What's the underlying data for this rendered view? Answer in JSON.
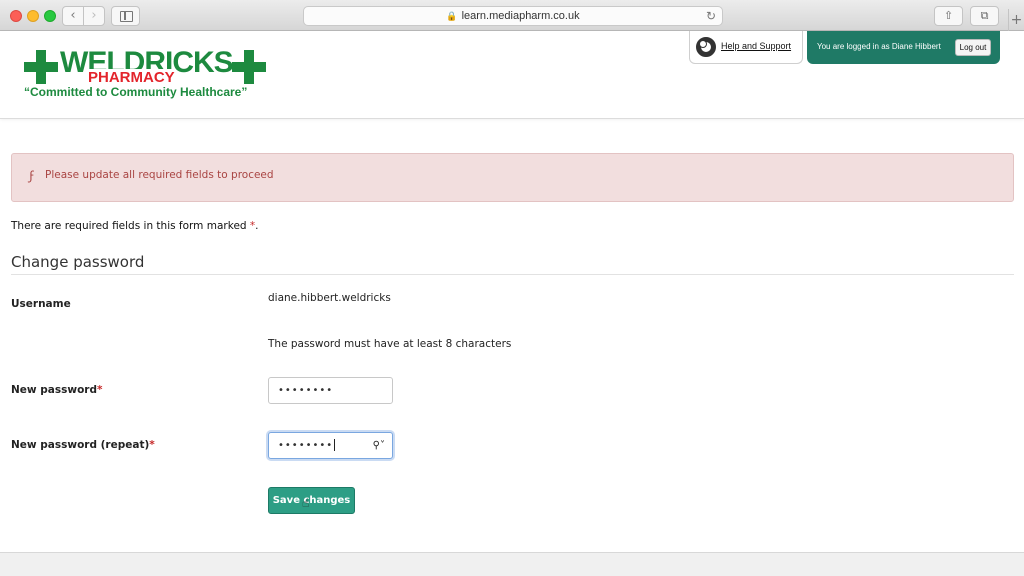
{
  "browser": {
    "url": "learn.mediapharm.co.uk"
  },
  "header": {
    "logo": {
      "word": "WELDRICKS",
      "sub": "PHARMACY",
      "tagline": "“Committed to Community Healthcare”"
    },
    "help_link": "Help and Support",
    "login_text": "You are logged in as Diane Hibbert",
    "logout_label": "Log out"
  },
  "alert": {
    "message": "Please update all required fields to proceed"
  },
  "form": {
    "required_note": "There are required fields in this form marked",
    "required_mark": "*",
    "required_note_end": ".",
    "legend": "Change password",
    "username_label": "Username",
    "username_value": "diane.hibbert.weldricks",
    "password_rule": "The password must have at least 8 characters",
    "new_password_label": "New password",
    "new_password_value": "••••••••",
    "new_password_repeat_label": "New password (repeat)",
    "new_password_repeat_value": "••••••••",
    "save_label": "Save changes"
  },
  "colors": {
    "brand_green": "#1d8a3f",
    "brand_red": "#e3242b",
    "header_teal": "#1f7a66",
    "button_teal": "#2d9e85",
    "alert_bg": "#f2dede",
    "alert_text": "#a94442"
  }
}
